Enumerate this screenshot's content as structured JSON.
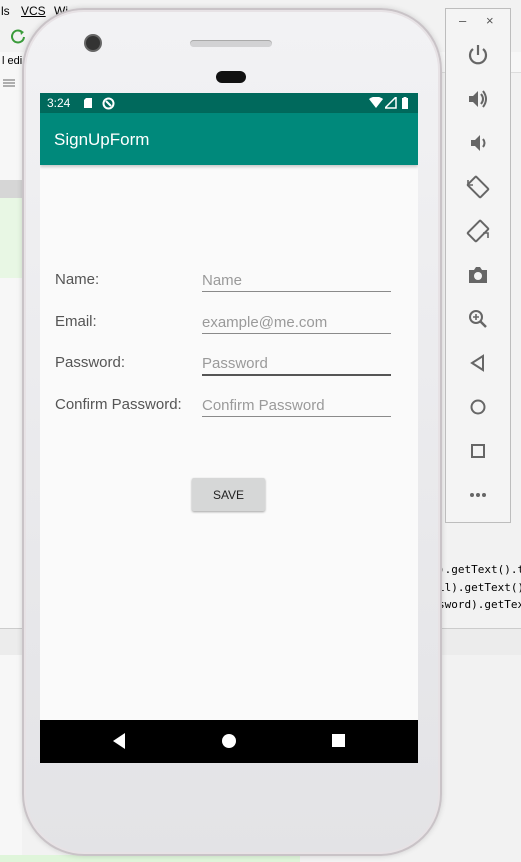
{
  "ide": {
    "menu": [
      "ls",
      "VCS",
      "Wi"
    ],
    "tab_label": "l edi",
    "code_lines": [
      ").getText().tc",
      "il).getText().",
      "sword).getText("
    ]
  },
  "app": {
    "status_time": "3:24",
    "title": "SignUpForm",
    "fields": [
      {
        "label": "Name:",
        "placeholder": "Name"
      },
      {
        "label": "Email:",
        "placeholder": "example@me.com"
      },
      {
        "label": "Password:",
        "placeholder": "Password"
      },
      {
        "label": "Confirm Password:",
        "placeholder": "Confirm Password"
      }
    ],
    "save_label": "SAVE"
  },
  "emulator": {
    "minimize": "–",
    "close": "×",
    "tools": [
      "power-icon",
      "volume-up-icon",
      "volume-down-icon",
      "rotate-left-icon",
      "rotate-right-icon",
      "camera-icon",
      "zoom-icon",
      "back-icon",
      "home-icon",
      "overview-icon",
      "more-icon"
    ]
  },
  "colors": {
    "status_bar": "#00695c",
    "app_bar": "#00897b",
    "screen_bg": "#fafafa",
    "nav_bar": "#000000"
  }
}
